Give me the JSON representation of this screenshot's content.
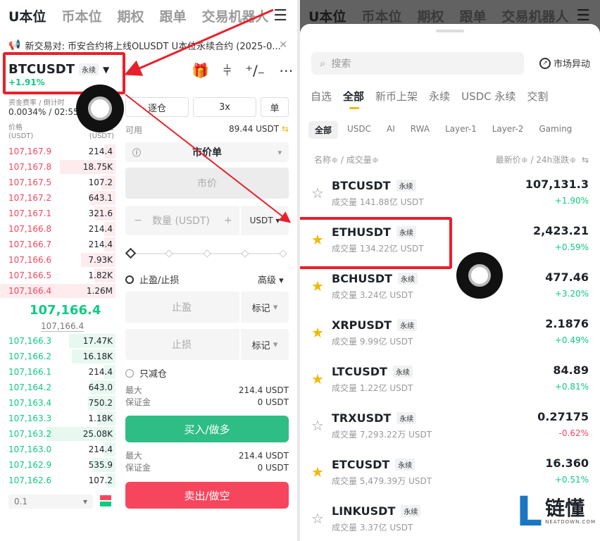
{
  "left": {
    "tabs": [
      "U本位",
      "币本位",
      "期权",
      "跟单",
      "交易机器人"
    ],
    "notice": "新交易对: 币安合约将上线OLUSDT U本位永续合约 (2025-0...",
    "symbol": "BTCUSDT",
    "symbol_tag": "永续",
    "change": "+1.91%",
    "funding_label": "资金费率 / 倒计时",
    "funding_value": "0.0034% / 02:55",
    "ob_price_label": "价格",
    "ob_price_unit": "(USDT)",
    "ob_qty_label": "数量",
    "ob_qty_unit": "(USDT)",
    "asks": [
      [
        "107,167.9",
        "214.4"
      ],
      [
        "107,167.8",
        "18.75K"
      ],
      [
        "107,167.5",
        "107.2"
      ],
      [
        "107,167.2",
        "643.1"
      ],
      [
        "107,167.1",
        "321.6"
      ],
      [
        "107,166.8",
        "214.4"
      ],
      [
        "107,166.7",
        "214.4"
      ],
      [
        "107,166.6",
        "7.93K"
      ],
      [
        "107,166.5",
        "1.82K"
      ],
      [
        "107,166.4",
        "1.26M"
      ]
    ],
    "last_price": "107,166.4",
    "mark_price": "107,166.4",
    "bids": [
      [
        "107,166.3",
        "17.47K"
      ],
      [
        "107,166.2",
        "16.18K"
      ],
      [
        "107,166.1",
        "214.4"
      ],
      [
        "107,164.2",
        "643.0"
      ],
      [
        "107,163.4",
        "750.2"
      ],
      [
        "107,163.3",
        "1.18K"
      ],
      [
        "107,163.2",
        "25.08K"
      ],
      [
        "107,163.0",
        "214.4"
      ],
      [
        "107,162.9",
        "535.9"
      ],
      [
        "107,162.6",
        "107.2"
      ]
    ],
    "precision": "0.1",
    "margin_mode": "逐仓",
    "leverage": "3x",
    "position_mode": "单",
    "avail_label": "可用",
    "avail_value": "89.44 USDT",
    "order_type": "市价单",
    "price_placeholder": "市价",
    "qty_placeholder": "数量 (USDT)",
    "qty_unit": "USDT",
    "tpsl_label": "止盈/止损",
    "advanced": "高级",
    "tp_label": "止盈",
    "sl_label": "止损",
    "trigger": "标记",
    "reduce_only": "只减仓",
    "max_label": "最大",
    "max_value": "214.4 USDT",
    "margin_label": "保证金",
    "margin_value": "0 USDT",
    "buy": "买入/做多",
    "sell": "卖出/做空"
  },
  "right": {
    "search_placeholder": "搜索",
    "market_alert": "市场异动",
    "categories": [
      "自选",
      "全部",
      "新币上架",
      "永续",
      "USDC 永续",
      "交割"
    ],
    "chips": [
      "全部",
      "USDC",
      "AI",
      "RWA",
      "Layer-1",
      "Layer-2",
      "Gaming"
    ],
    "head_left": "名称≑ / 成交量≑",
    "head_right": "最新价≑ / 24h涨跌≑",
    "items": [
      {
        "name": "BTCUSDT",
        "tag": "永续",
        "vol": "成交量 141.88亿 USDT",
        "price": "107,131.3",
        "change": "+1.90%",
        "starred": false,
        "up": true
      },
      {
        "name": "ETHUSDT",
        "tag": "永续",
        "vol": "成交量 134.22亿 USDT",
        "price": "2,423.21",
        "change": "+0.59%",
        "starred": true,
        "up": true
      },
      {
        "name": "BCHUSDT",
        "tag": "永续",
        "vol": "成交量 3.24亿 USDT",
        "price": "477.46",
        "change": "+3.20%",
        "starred": true,
        "up": true
      },
      {
        "name": "XRPUSDT",
        "tag": "永续",
        "vol": "成交量 9.99亿 USDT",
        "price": "2.1876",
        "change": "+0.49%",
        "starred": true,
        "up": true
      },
      {
        "name": "LTCUSDT",
        "tag": "永续",
        "vol": "成交量 1.22亿 USDT",
        "price": "84.89",
        "change": "+0.81%",
        "starred": true,
        "up": true
      },
      {
        "name": "TRXUSDT",
        "tag": "永续",
        "vol": "成交量 7,293.22万 USDT",
        "price": "0.27175",
        "change": "-0.62%",
        "starred": false,
        "up": false
      },
      {
        "name": "ETCUSDT",
        "tag": "永续",
        "vol": "成交量 5,479.39万 USDT",
        "price": "16.360",
        "change": "+0.51%",
        "starred": true,
        "up": true
      },
      {
        "name": "LINKUSDT",
        "tag": "永续",
        "vol": "成交量 3.37亿 USDT",
        "price": "",
        "change": "",
        "starred": false,
        "up": true
      }
    ],
    "logo_text": "链懂",
    "logo_sub": "NEATDOWN.COM"
  },
  "colors": {
    "green": "#0ecb81",
    "red": "#f6465d",
    "yellow": "#f0b90b",
    "annotation": "#e8202a"
  }
}
